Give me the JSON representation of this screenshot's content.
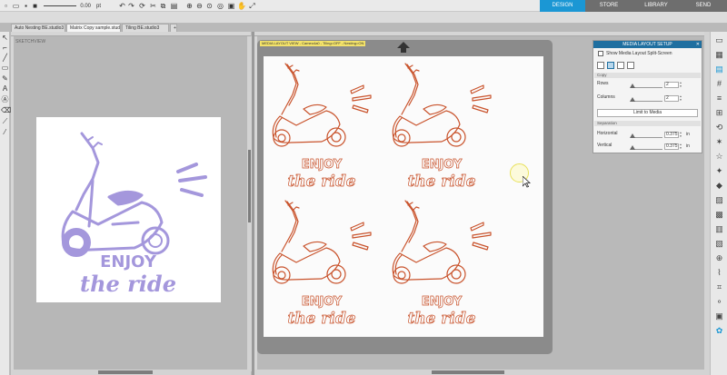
{
  "toolbar": {
    "line_width_value": "0.00",
    "line_width_unit": "pt"
  },
  "nav": {
    "design": "DESIGN",
    "store": "STORE",
    "library": "LIBRARY",
    "send": "SEND"
  },
  "doc_tabs": [
    {
      "label": "Auto Nesting BE.studio3",
      "active": false
    },
    {
      "label": "Matrix Copy sample.studio3",
      "active": true
    },
    {
      "label": "Tiling BE.studio3",
      "active": false
    },
    {
      "label": "+",
      "active": false
    }
  ],
  "left_view_label": "SKETCHVIEW",
  "design": {
    "line1": "ENJOY",
    "line2": "the ride",
    "fill_color": "#a497dc",
    "cut_color": "#c9532c"
  },
  "mat_label": "MEDIA LAYOUT VIEW - Cameo4a0 - Tiling=OFF - Nesting=ON",
  "panel": {
    "title": "MEDIA LAYOUT SETUP",
    "split_label": "Show Media Layout Split-Screen",
    "copy_header": "Copy",
    "rows_label": "Rows",
    "rows_value": "2",
    "columns_label": "Columns",
    "columns_value": "2",
    "limit_button": "Limit to Media",
    "separation_header": "Separation",
    "horizontal_label": "Horizontal",
    "horizontal_value": "0.375",
    "vertical_label": "Vertical",
    "vertical_value": "0.375",
    "unit": "in"
  },
  "colors": {
    "accent": "#1b97d4",
    "nav_inactive": "#6e6e6e",
    "panel_header": "#1f6fa0",
    "mat_label": "#f4e36a"
  }
}
